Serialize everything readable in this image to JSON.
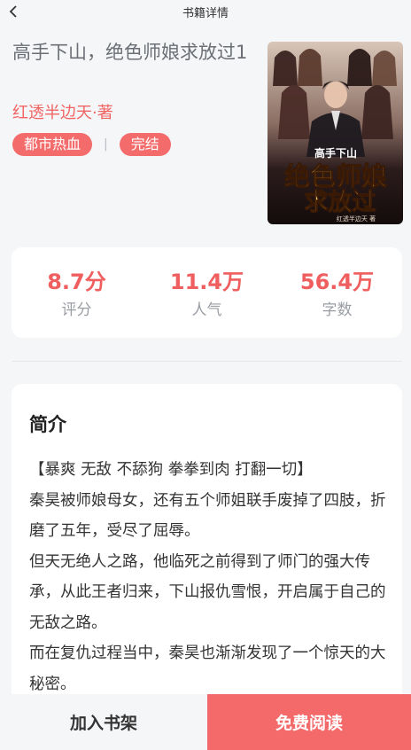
{
  "header": {
    "title": "书籍详情",
    "back_icon": "chevron-left-icon"
  },
  "book": {
    "title": "高手下山，绝色师娘求放过1",
    "author": "红透半边天·著",
    "tags": [
      "都市热血",
      "完结"
    ],
    "tag_separator": "|",
    "cover": {
      "small_title": "高手下山",
      "main_title_line1": "绝色师娘",
      "main_title_line2": "求放过",
      "author": "红透半边天 著"
    }
  },
  "stats": [
    {
      "value": "8.7分",
      "label": "评分"
    },
    {
      "value": "11.4万",
      "label": "人气"
    },
    {
      "value": "56.4万",
      "label": "字数"
    }
  ],
  "intro": {
    "heading": "简介",
    "paragraphs": [
      "【暴爽 无敌 不舔狗 拳拳到肉 打翻一切】",
      "秦昊被师娘母女，还有五个师姐联手废掉了四肢，折磨了五年，受尽了屈辱。",
      "但天无绝人之路，他临死之前得到了师门的强大传承，从此王者归来，下山报仇雪恨，开启属于自己的无敌之路。",
      "而在复仇过程当中，秦昊也渐渐发现了一个惊天的大秘密。"
    ]
  },
  "actions": {
    "add_shelf": "加入书架",
    "read_free": "免费阅读"
  },
  "colors": {
    "accent": "#f46a6a",
    "background": "#f5f6f8"
  }
}
